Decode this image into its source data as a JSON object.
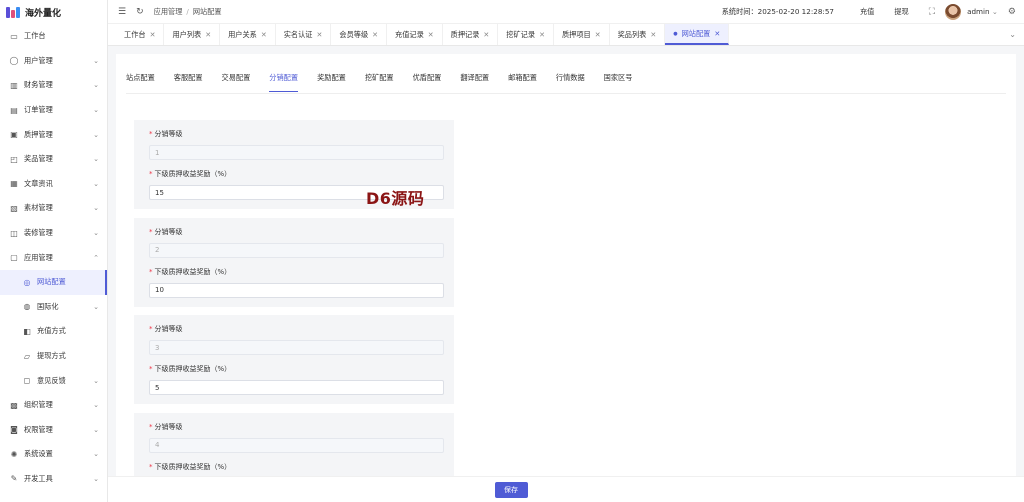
{
  "app": {
    "title": "海外量化"
  },
  "sidebar": {
    "items": [
      {
        "label": "工作台",
        "icon": "monitor-icon",
        "chevron": ""
      },
      {
        "label": "用户管理",
        "icon": "user-icon",
        "chevron": "⌄"
      },
      {
        "label": "财务管理",
        "icon": "chart-icon",
        "chevron": "⌄"
      },
      {
        "label": "订单管理",
        "icon": "order-icon",
        "chevron": "⌄"
      },
      {
        "label": "质押管理",
        "icon": "pledge-icon",
        "chevron": "⌄"
      },
      {
        "label": "奖品管理",
        "icon": "gift-icon",
        "chevron": "⌄"
      },
      {
        "label": "文章资讯",
        "icon": "article-icon",
        "chevron": "⌄"
      },
      {
        "label": "素材管理",
        "icon": "material-icon",
        "chevron": "⌄"
      },
      {
        "label": "装修管理",
        "icon": "decor-icon",
        "chevron": "⌄"
      },
      {
        "label": "应用管理",
        "icon": "app-icon",
        "chevron": "⌃"
      },
      {
        "label": "网站配置",
        "icon": "globe-icon",
        "chevron": "",
        "sub": true,
        "active": true
      },
      {
        "label": "国际化",
        "icon": "i18n-icon",
        "chevron": "⌄",
        "sub": true
      },
      {
        "label": "充值方式",
        "icon": "recharge-icon",
        "chevron": "",
        "sub": true
      },
      {
        "label": "提现方式",
        "icon": "withdraw-icon",
        "chevron": "",
        "sub": true
      },
      {
        "label": "意见反馈",
        "icon": "feedback-icon",
        "chevron": "⌄",
        "sub": true
      },
      {
        "label": "组织管理",
        "icon": "org-icon",
        "chevron": "⌄"
      },
      {
        "label": "权限管理",
        "icon": "lock-icon",
        "chevron": "⌄"
      },
      {
        "label": "系统设置",
        "icon": "settings-icon",
        "chevron": "⌄"
      },
      {
        "label": "开发工具",
        "icon": "tool-icon",
        "chevron": "⌄"
      }
    ]
  },
  "header": {
    "breadcrumb": [
      "应用管理",
      "网站配置"
    ],
    "system_time": "系统时间：2025-02-20 12:28:57",
    "recharge": "充值",
    "withdraw": "提现",
    "user": "admin"
  },
  "tabs": [
    {
      "label": "工作台",
      "active": false
    },
    {
      "label": "用户列表",
      "active": false
    },
    {
      "label": "用户关系",
      "active": false
    },
    {
      "label": "实名认证",
      "active": false
    },
    {
      "label": "会员等级",
      "active": false
    },
    {
      "label": "充值记录",
      "active": false
    },
    {
      "label": "质押记录",
      "active": false
    },
    {
      "label": "挖矿记录",
      "active": false
    },
    {
      "label": "质押项目",
      "active": false
    },
    {
      "label": "奖品列表",
      "active": false
    },
    {
      "label": "网站配置",
      "active": true
    }
  ],
  "subtabs": [
    {
      "label": "站点配置",
      "active": false
    },
    {
      "label": "客服配置",
      "active": false
    },
    {
      "label": "交易配置",
      "active": false
    },
    {
      "label": "分销配置",
      "active": true
    },
    {
      "label": "奖励配置",
      "active": false
    },
    {
      "label": "挖矿配置",
      "active": false
    },
    {
      "label": "优盾配置",
      "active": false
    },
    {
      "label": "翻译配置",
      "active": false
    },
    {
      "label": "邮箱配置",
      "active": false
    },
    {
      "label": "行情数据",
      "active": false
    },
    {
      "label": "国家区号",
      "active": false
    }
  ],
  "form": {
    "level_label": "分销等级",
    "reward_label": "下级质押收益奖励（%）",
    "cards": [
      {
        "level": "1",
        "reward": "15"
      },
      {
        "level": "2",
        "reward": "10"
      },
      {
        "level": "3",
        "reward": "5"
      },
      {
        "level": "4",
        "reward": ""
      }
    ]
  },
  "watermark": "D6源码",
  "footer": {
    "save_label": "保存"
  },
  "colors": {
    "accent": "#4f5bd5",
    "watermark": "#8b1515"
  }
}
